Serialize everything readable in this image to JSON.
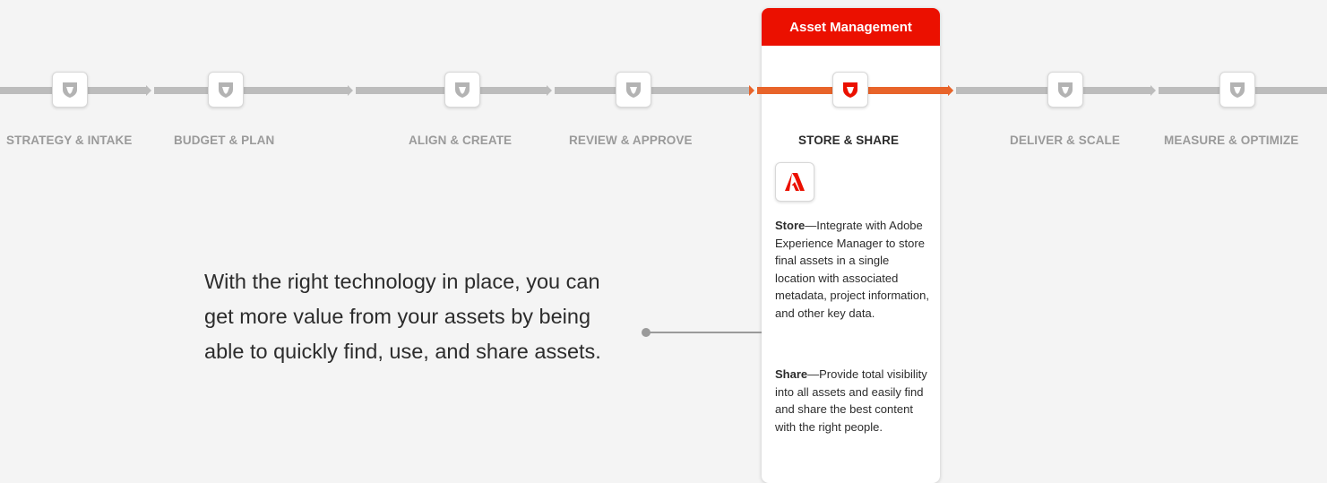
{
  "card": {
    "header": "Asset Management"
  },
  "stages": [
    {
      "label": "STRATEGY & INTAKE",
      "active": false
    },
    {
      "label": "BUDGET & PLAN",
      "active": false
    },
    {
      "label": "ALIGN & CREATE",
      "active": false
    },
    {
      "label": "REVIEW & APPROVE",
      "active": false
    },
    {
      "label": "STORE & SHARE",
      "active": true
    },
    {
      "label": "DELIVER & SCALE",
      "active": false
    },
    {
      "label": "MEASURE & OPTIMIZE",
      "active": false
    }
  ],
  "store": {
    "title": "Store",
    "text": "—Integrate with Adobe Experience Manager to store final assets in a single location with associated metadata, project information, and other key data."
  },
  "share": {
    "title": "Share",
    "text": "—Provide total visibility into all assets and easily find and share the best content with the right people."
  },
  "main_text": "With the right technology in place, you can get more value from your assets by being able to quickly find, use, and share assets.",
  "colors": {
    "accent": "#eb1000",
    "track_active": "#e8642a",
    "track": "#bcbcbc",
    "node_icon": "#b3b3b3"
  },
  "icons": {
    "stage_node": "lion-badge-icon",
    "app": "adobe-logo-icon"
  }
}
